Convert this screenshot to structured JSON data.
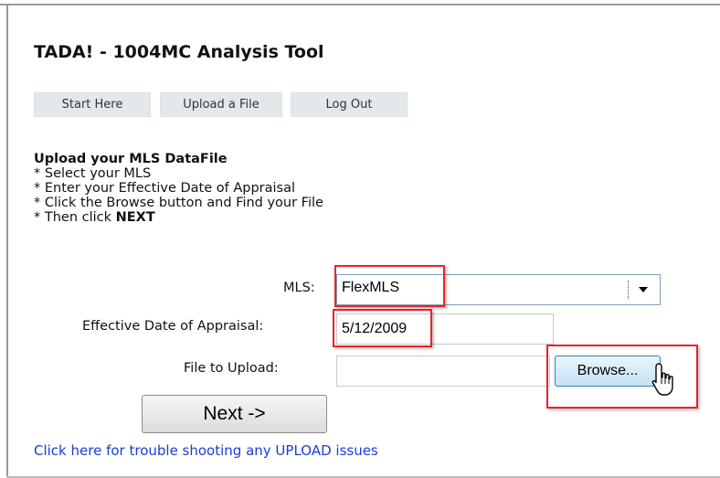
{
  "app": {
    "title": "TADA! - 1004MC Analysis Tool"
  },
  "tabs": [
    {
      "label": "Start Here"
    },
    {
      "label": "Upload a File"
    },
    {
      "label": "Log Out"
    }
  ],
  "instructions": {
    "heading": "Upload your MLS DataFile",
    "lines": [
      "* Select your MLS",
      "* Enter your Effective Date of Appraisal",
      "* Click the Browse button and Find your File"
    ],
    "last_line_prefix": "* Then click ",
    "last_line_bold": "NEXT"
  },
  "form": {
    "mls_label": "MLS:",
    "mls_value": "FlexMLS",
    "date_label": "Effective Date of Appraisal:",
    "date_value": "5/12/2009",
    "file_label": "File to Upload:",
    "file_value": "",
    "browse_label": "Browse...",
    "next_label": "Next ->"
  },
  "help_link": "Click here for trouble shooting any UPLOAD issues",
  "colors": {
    "highlight": "#e8232a",
    "link": "#1a3ed6",
    "tab_bg": "#e3e8ea",
    "browse_bg": "#c3e2f6"
  },
  "icons": {
    "dropdown": "chevron-down-icon",
    "pointer": "hand-cursor-icon"
  }
}
